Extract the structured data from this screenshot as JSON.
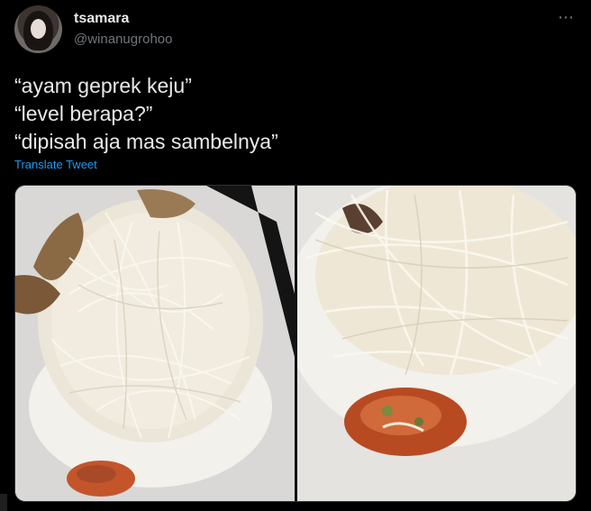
{
  "tweet": {
    "display_name": "tsamara",
    "handle": "@winanugrohoo",
    "more_icon": "more-horizontal-icon",
    "lines": [
      "“ayam geprek keju”",
      "“level berapa?”",
      "“dipisah aja mas sambelnya”"
    ],
    "translate_label": "Translate Tweet"
  },
  "colors": {
    "background": "#000000",
    "text": "#e7e9ea",
    "secondary": "#71767b",
    "link": "#1d9bf0"
  }
}
